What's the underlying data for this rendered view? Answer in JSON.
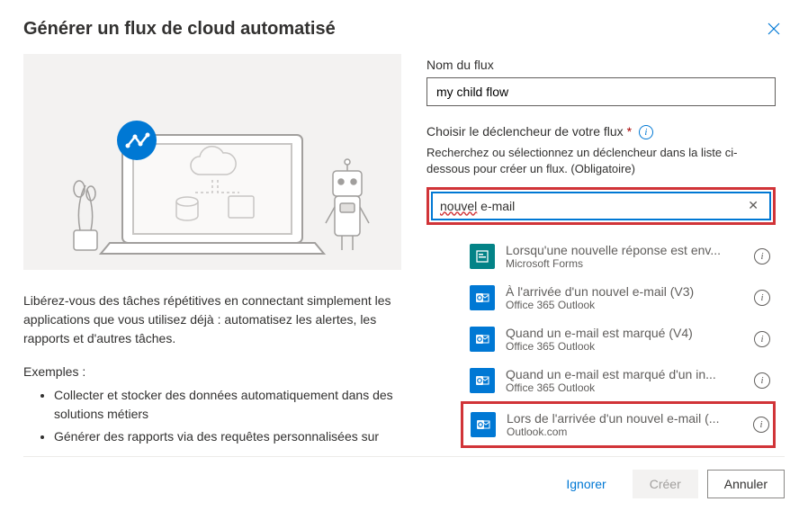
{
  "header": {
    "title": "Générer un flux de cloud automatisé"
  },
  "left": {
    "description": "Libérez-vous des tâches répétitives en connectant simplement les applications que vous utilisez déjà : automatisez les alertes, les rapports et d'autres tâches.",
    "examples_label": "Exemples :",
    "examples": [
      "Collecter et stocker des données automatiquement dans des solutions métiers",
      "Générer des rapports via des requêtes personnalisées sur votre base de données SQL"
    ]
  },
  "right": {
    "name_label": "Nom du flux",
    "name_value": "my child flow",
    "trigger_label": "Choisir le déclencheur de votre flux",
    "trigger_hint": "Recherchez ou sélectionnez un déclencheur dans la liste ci-dessous pour créer un flux. (Obligatoire)",
    "search_prefix": "nouvel",
    "search_suffix": " e-mail",
    "triggers": [
      {
        "title": "Lorsqu'une nouvelle réponse est env...",
        "sub": "Microsoft Forms",
        "icon": "forms"
      },
      {
        "title": "À l'arrivée d'un nouvel e-mail (V3)",
        "sub": "Office 365 Outlook",
        "icon": "outlook"
      },
      {
        "title": "Quand un e-mail est marqué (V4)",
        "sub": "Office 365 Outlook",
        "icon": "outlook"
      },
      {
        "title": "Quand un e-mail est marqué d'un in...",
        "sub": "Office 365 Outlook",
        "icon": "outlook"
      },
      {
        "title": "Lors de l'arrivée d'un nouvel e-mail (...",
        "sub": "Outlook.com",
        "icon": "outlook",
        "highlight": true
      }
    ]
  },
  "footer": {
    "ignore": "Ignorer",
    "create": "Créer",
    "cancel": "Annuler"
  }
}
